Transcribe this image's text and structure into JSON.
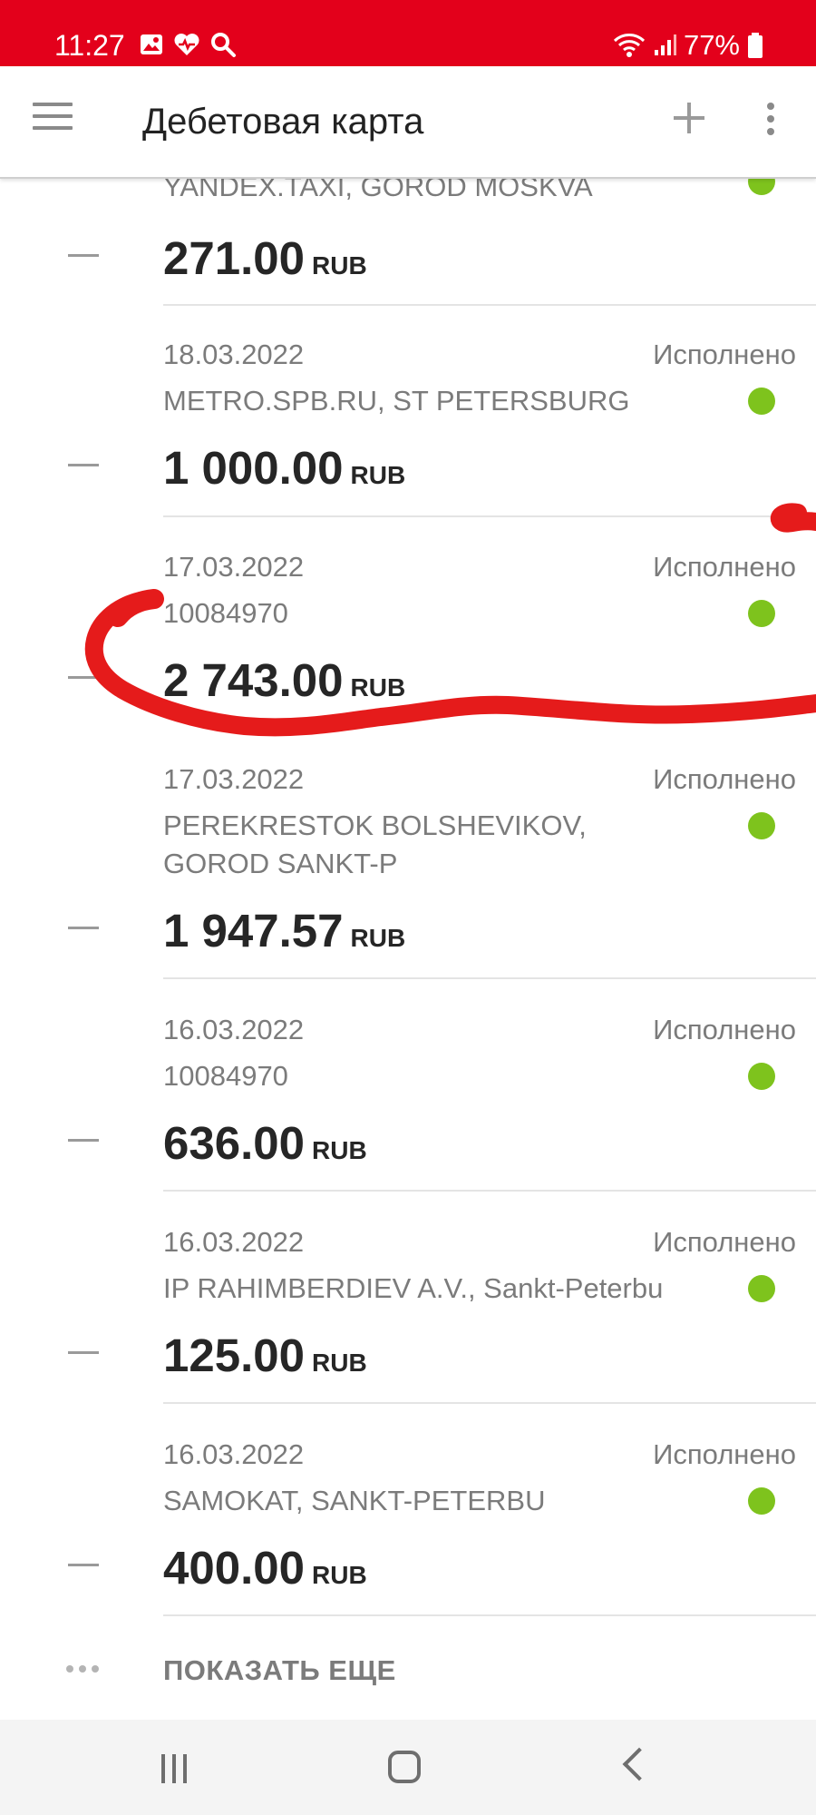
{
  "status_bar": {
    "time": "11:27",
    "battery": "77%",
    "icons_left": [
      "gallery-icon",
      "health-icon",
      "search-icon"
    ],
    "icons_right": [
      "wifi-icon",
      "signal-icon",
      "battery-icon"
    ]
  },
  "app_bar": {
    "title": "Дебетовая карта",
    "icons": [
      "menu-icon",
      "plus-icon",
      "more-vert-icon"
    ]
  },
  "colors": {
    "brand_red": "#e3001b",
    "status_green": "#7ec31d",
    "scribble_red": "#e51b1b"
  },
  "transactions": [
    {
      "date": "",
      "merchant": "YANDEX.TAXI, GOROD MOSKVA",
      "status": "",
      "amount": "271.00",
      "currency": "RUB",
      "sign": "—"
    },
    {
      "date": "18.03.2022",
      "merchant": "METRO.SPB.RU, ST PETERSBURG",
      "status": "Исполнено",
      "amount": "1 000.00",
      "currency": "RUB",
      "sign": "—"
    },
    {
      "date": "17.03.2022",
      "merchant": "10084970",
      "status": "Исполнено",
      "amount": "2 743.00",
      "currency": "RUB",
      "sign": "—"
    },
    {
      "date": "17.03.2022",
      "merchant": "PEREKRESTOK BOLSHEVIKOV, GOROD SANKT-P",
      "status": "Исполнено",
      "amount": "1 947.57",
      "currency": "RUB",
      "sign": "—"
    },
    {
      "date": "16.03.2022",
      "merchant": "10084970",
      "status": "Исполнено",
      "amount": "636.00",
      "currency": "RUB",
      "sign": "—"
    },
    {
      "date": "16.03.2022",
      "merchant": "IP RAHIMBERDIEV A.V., Sankt-Peterbu",
      "status": "Исполнено",
      "amount": "125.00",
      "currency": "RUB",
      "sign": "—"
    },
    {
      "date": "16.03.2022",
      "merchant": "SAMOKAT, SANKT-PETERBU",
      "status": "Исполнено",
      "amount": "400.00",
      "currency": "RUB",
      "sign": "—"
    }
  ],
  "show_more_label": "ПОКАЗАТЬ ЕЩЕ",
  "nav_bar": {
    "icons": [
      "recents-icon",
      "home-icon",
      "back-icon"
    ]
  }
}
